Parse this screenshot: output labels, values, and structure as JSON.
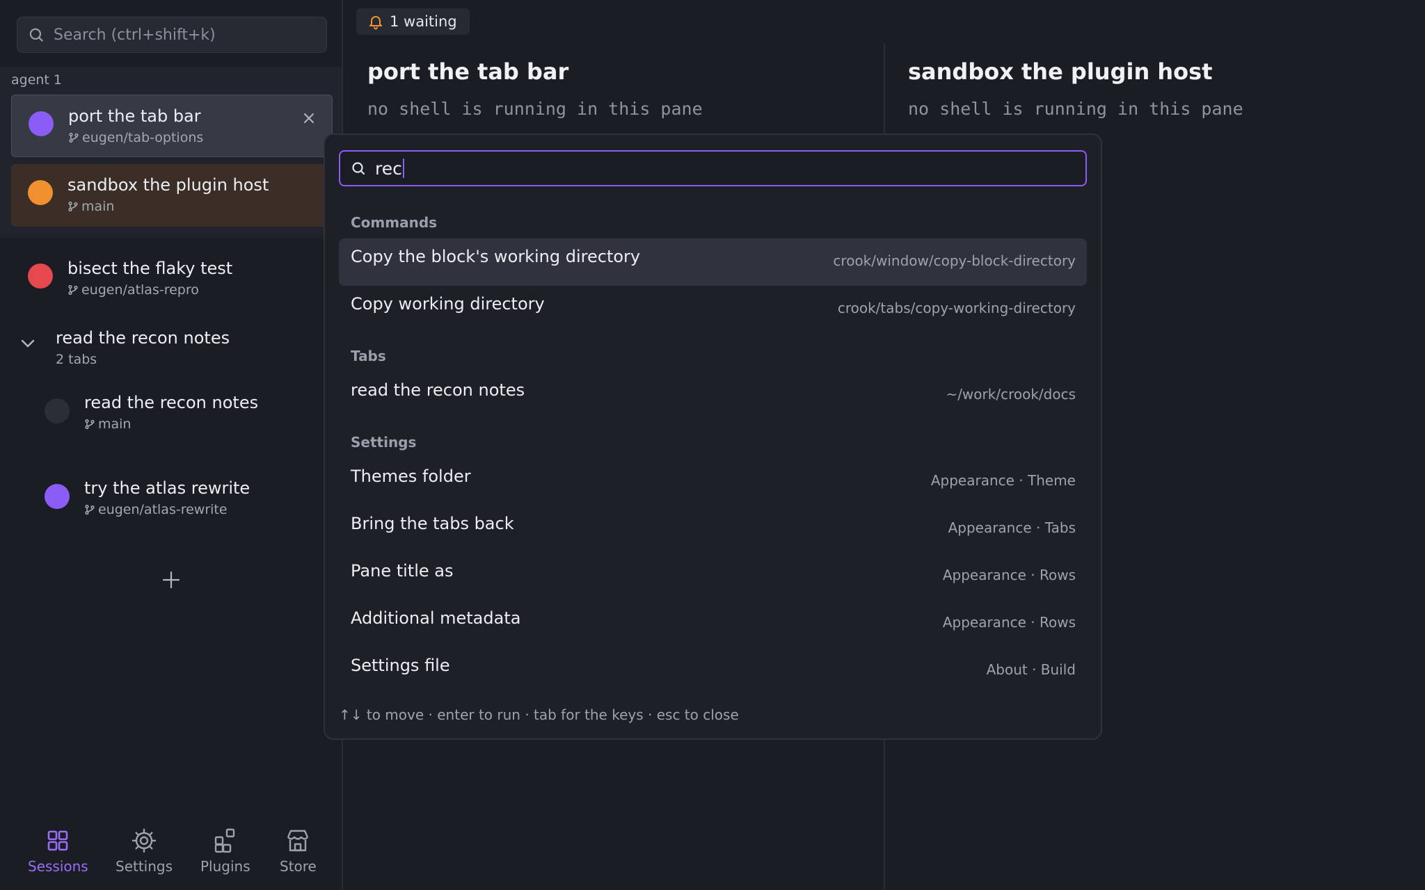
{
  "sidebar": {
    "search_placeholder": "Search (ctrl+shift+k)",
    "group_label": "agent 1",
    "sessions": [
      {
        "title": "port the tab bar",
        "branch": "eugen/tab-options",
        "color": "#8b5cf6"
      },
      {
        "title": "sandbox the plugin host",
        "branch": "main",
        "color": "#f0902f"
      },
      {
        "title": "bisect the flaky test",
        "branch": "eugen/atlas-repro",
        "color": "#e5484d"
      }
    ],
    "folder": {
      "title": "read the recon notes",
      "count": "2 tabs"
    },
    "folder_children": [
      {
        "title": "read the recon notes",
        "branch": "main",
        "color": "#2b2e37"
      },
      {
        "title": "try the atlas rewrite",
        "branch": "eugen/atlas-rewrite",
        "color": "#8b5cf6"
      }
    ],
    "nav": [
      {
        "label": "Sessions",
        "icon": "grid-icon",
        "active": true
      },
      {
        "label": "Settings",
        "icon": "gear-icon"
      },
      {
        "label": "Plugins",
        "icon": "plugins-icon"
      },
      {
        "label": "Store",
        "icon": "store-icon"
      }
    ]
  },
  "main": {
    "waiting_badge": "1 waiting",
    "panes": [
      {
        "title": "port the tab bar",
        "subtitle": "no shell is running in this pane"
      },
      {
        "title": "sandbox the plugin host",
        "subtitle": "no shell is running in this pane"
      }
    ]
  },
  "palette": {
    "query": "rec",
    "sections": {
      "commands": "Commands",
      "tabs": "Tabs",
      "settings": "Settings"
    },
    "commands": [
      {
        "label": "Copy the block's working directory",
        "meta": "crook/window/copy-block-directory"
      },
      {
        "label": "Copy working directory",
        "meta": "crook/tabs/copy-working-directory"
      }
    ],
    "tabs": [
      {
        "label": "read the recon notes",
        "meta": "~/work/crook/docs"
      }
    ],
    "settings": [
      {
        "label": "Themes folder",
        "meta": "Appearance · Theme"
      },
      {
        "label": "Bring the tabs back",
        "meta": "Appearance · Tabs"
      },
      {
        "label": "Pane title as",
        "meta": "Appearance · Rows"
      },
      {
        "label": "Additional metadata",
        "meta": "Appearance · Rows"
      },
      {
        "label": "Settings file",
        "meta": "About · Build"
      }
    ],
    "footer": "↑↓ to move · enter to run · tab for the keys · esc to close"
  },
  "colors": {
    "accent": "#8b5cf6",
    "bell": "#f0902f"
  }
}
